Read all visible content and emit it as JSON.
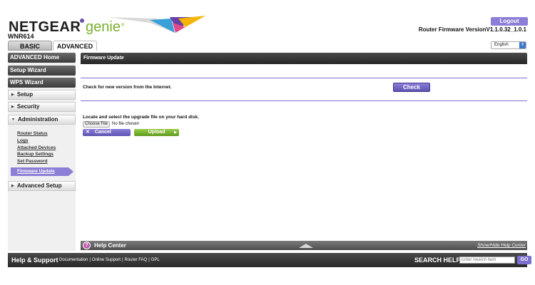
{
  "header": {
    "brand": "NETGEAR",
    "product": "genie",
    "trademark": "®",
    "model": "WNR614",
    "logout_label": "Logout",
    "firmware_version": "Router Firmware VersionV1.1.0.32_1.0.1",
    "tabs": [
      {
        "label": "BASIC"
      },
      {
        "label": "ADVANCED"
      }
    ],
    "language": "English"
  },
  "sidebar": {
    "main_items": [
      {
        "label": "ADVANCED Home"
      },
      {
        "label": "Setup Wizard"
      },
      {
        "label": "WPS Wizard"
      }
    ],
    "sections": [
      {
        "label": "Setup"
      },
      {
        "label": "Security"
      },
      {
        "label": "Administration"
      },
      {
        "label": "Advanced Setup"
      }
    ],
    "admin_items": [
      {
        "label": "Router Status"
      },
      {
        "label": "Logs"
      },
      {
        "label": "Attached Devices"
      },
      {
        "label": "Backup Settings"
      },
      {
        "label": "Set Password"
      },
      {
        "label": "Firmware Update"
      }
    ]
  },
  "main": {
    "title": "Firmware Update",
    "check_text": "Check for new version from the Internet.",
    "check_label": "Check",
    "locate_text": "Locate and select the upgrade file on your hard disk.",
    "choose_file_label": "Choose File",
    "no_file_text": "No file chosen",
    "cancel_label": "Cancel",
    "upload_label": "Upload"
  },
  "help_center": {
    "label": "Help Center",
    "toggle_label": "Show/Hide Help Center"
  },
  "footer": {
    "title": "Help & Support",
    "links": [
      {
        "label": "Documentation"
      },
      {
        "label": "Online Support"
      },
      {
        "label": "Router FAQ"
      },
      {
        "label": "GPL"
      }
    ],
    "search_label": "SEARCH HELP",
    "search_placeholder": "Enter Search Item",
    "go_label": "GO"
  },
  "colors": {
    "accent_purple": "#8b7ed6",
    "accent_green": "#7ab02b",
    "dark_bar": "#3c3c3c"
  }
}
